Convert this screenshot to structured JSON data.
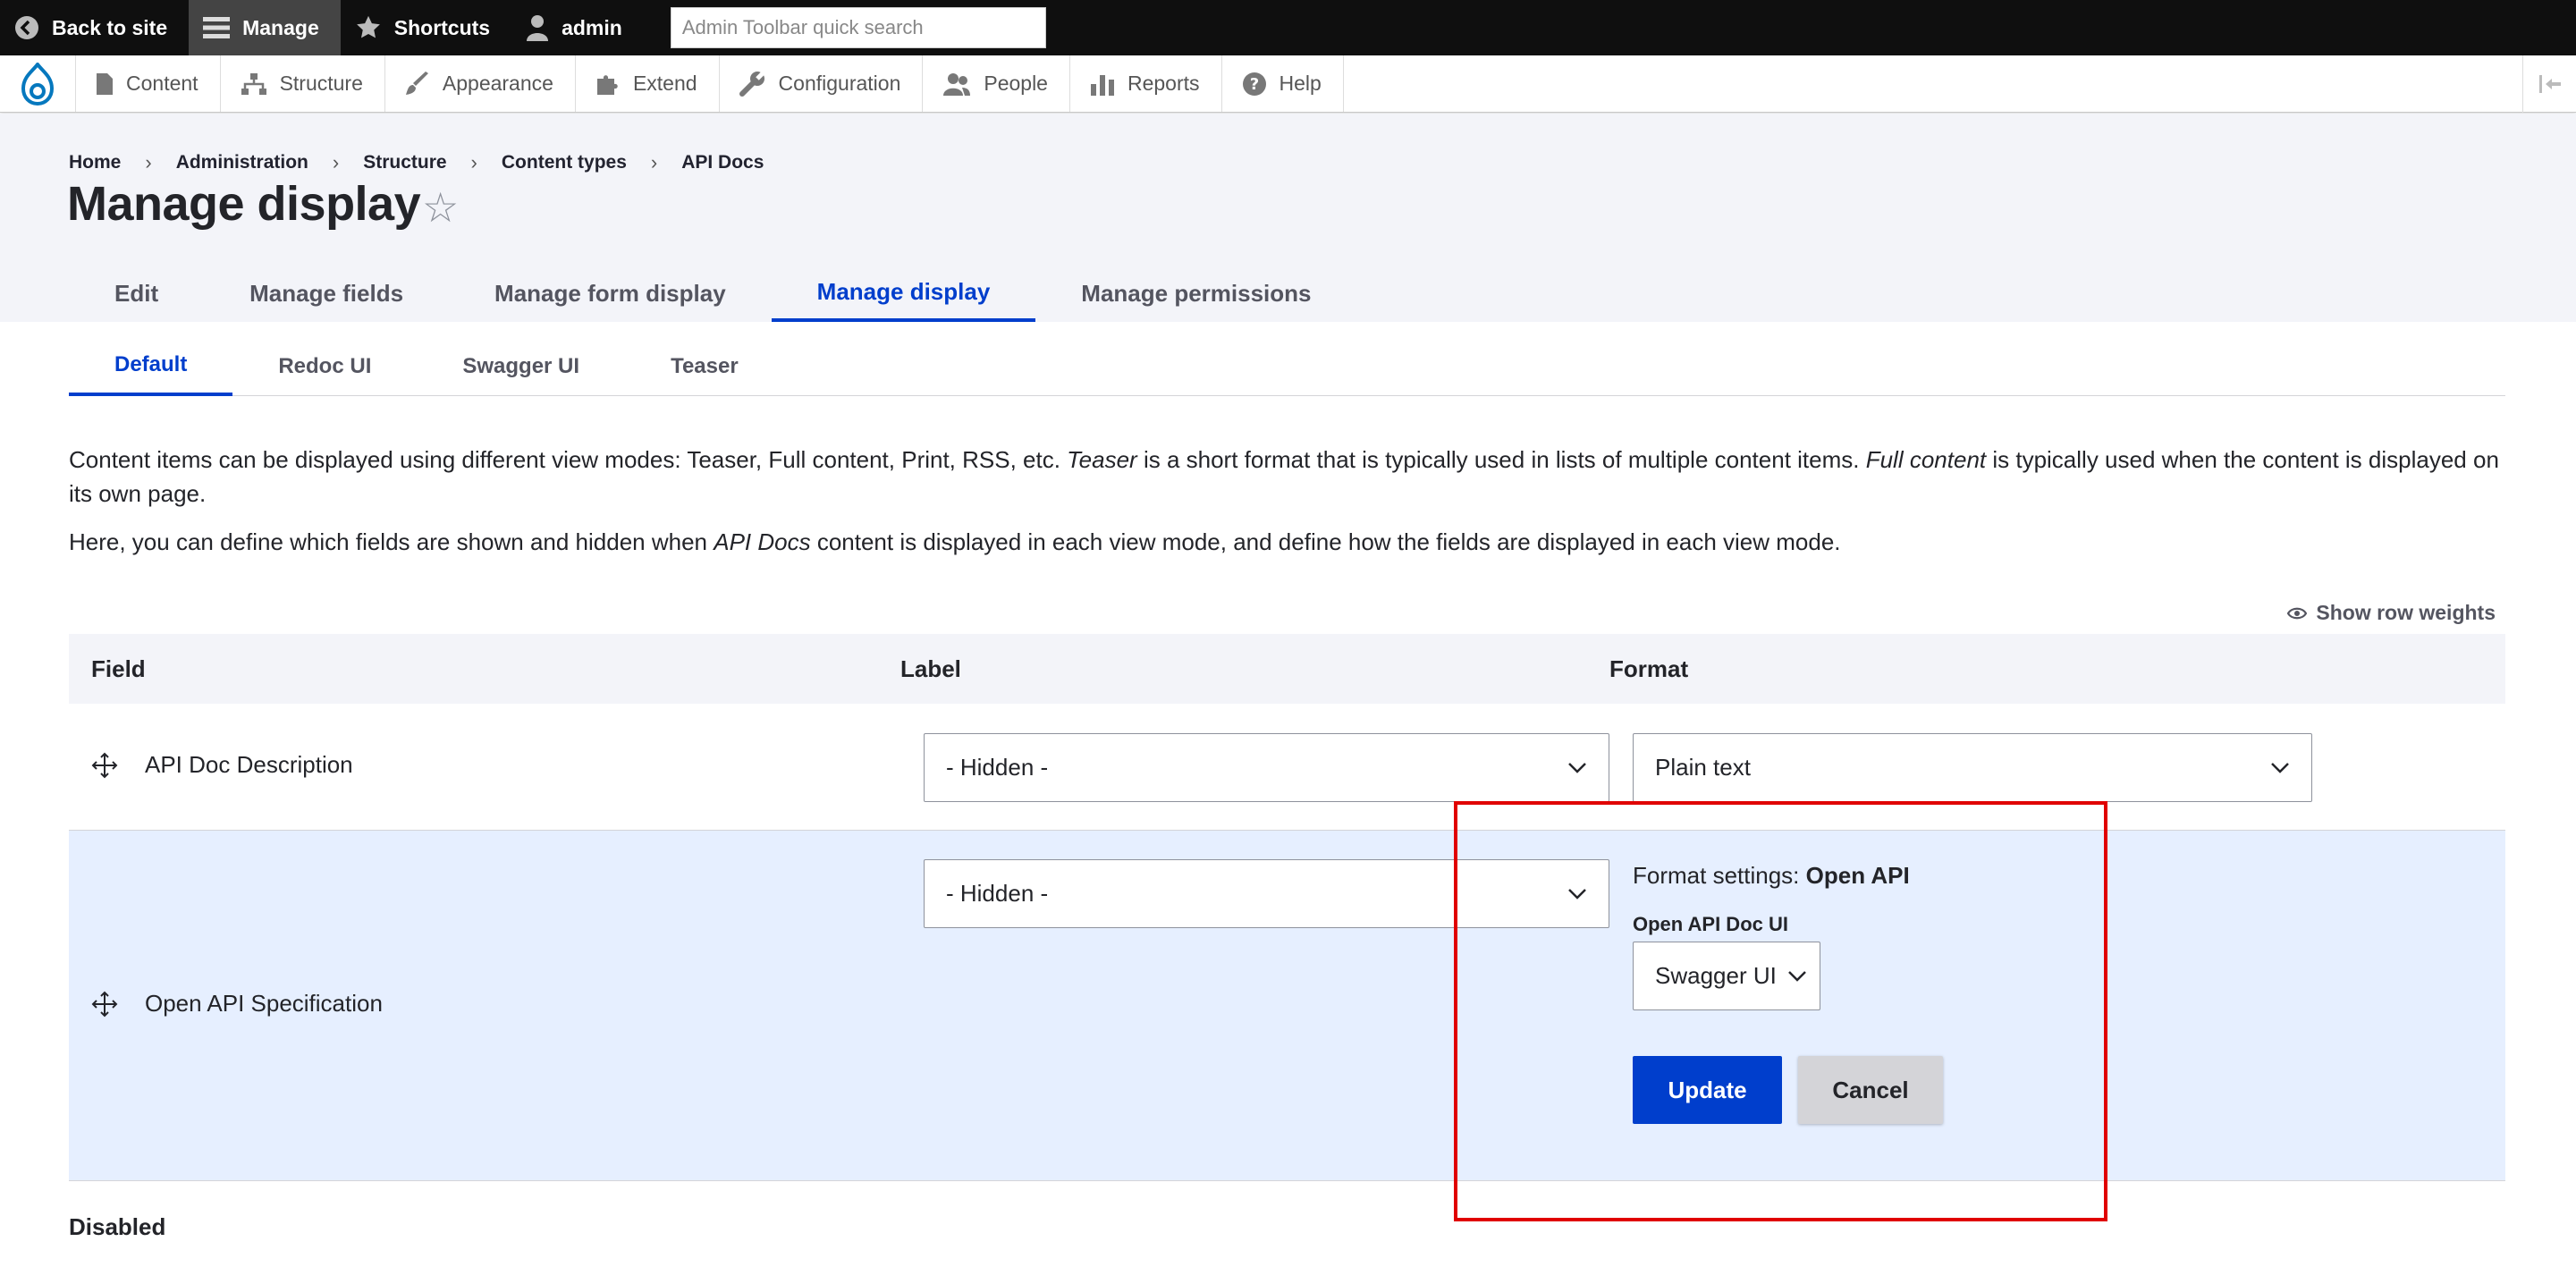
{
  "toolbar": {
    "back_label": "Back to site",
    "manage_label": "Manage",
    "shortcuts_label": "Shortcuts",
    "user_label": "admin",
    "search_placeholder": "Admin Toolbar quick search"
  },
  "admin_menu": {
    "items": [
      "Content",
      "Structure",
      "Appearance",
      "Extend",
      "Configuration",
      "People",
      "Reports",
      "Help"
    ]
  },
  "breadcrumb": [
    "Home",
    "Administration",
    "Structure",
    "Content types",
    "API Docs"
  ],
  "page": {
    "title": "Manage display",
    "star": "☆"
  },
  "primary_tabs": {
    "items": [
      "Edit",
      "Manage fields",
      "Manage form display",
      "Manage display",
      "Manage permissions"
    ],
    "active": "Manage display"
  },
  "secondary_tabs": {
    "items": [
      "Default",
      "Redoc UI",
      "Swagger UI",
      "Teaser"
    ],
    "active": "Default"
  },
  "description": {
    "p1_a": "Content items can be displayed using different view modes: Teaser, Full content, Print, RSS, etc. ",
    "p1_em1": "Teaser",
    "p1_b": " is a short format that is typically used in lists of multiple content items. ",
    "p1_em2": "Full content",
    "p1_c": " is typically used when the content is displayed on its own page.",
    "p2_a": "Here, you can define which fields are shown and hidden when ",
    "p2_em": "API Docs",
    "p2_b": " content is displayed in each view mode, and define how the fields are displayed in each view mode."
  },
  "show_row_weights": "Show row weights",
  "table": {
    "headers": {
      "field": "Field",
      "label": "Label",
      "format": "Format"
    },
    "rows": [
      {
        "field": "API Doc Description",
        "label": "- Hidden -",
        "format": "Plain text"
      },
      {
        "field": "Open API Specification",
        "label": "- Hidden -",
        "format_settings_prefix": "Format settings: ",
        "format_settings_name": "Open API",
        "ui_label": "Open API Doc UI",
        "ui_value": "Swagger UI",
        "update": "Update",
        "cancel": "Cancel"
      }
    ]
  },
  "disabled_label": "Disabled",
  "colors": {
    "accent": "#003ecc",
    "highlight": "#e00000",
    "header_bg": "#f3f4f9",
    "edit_row_bg": "#e6efff"
  }
}
